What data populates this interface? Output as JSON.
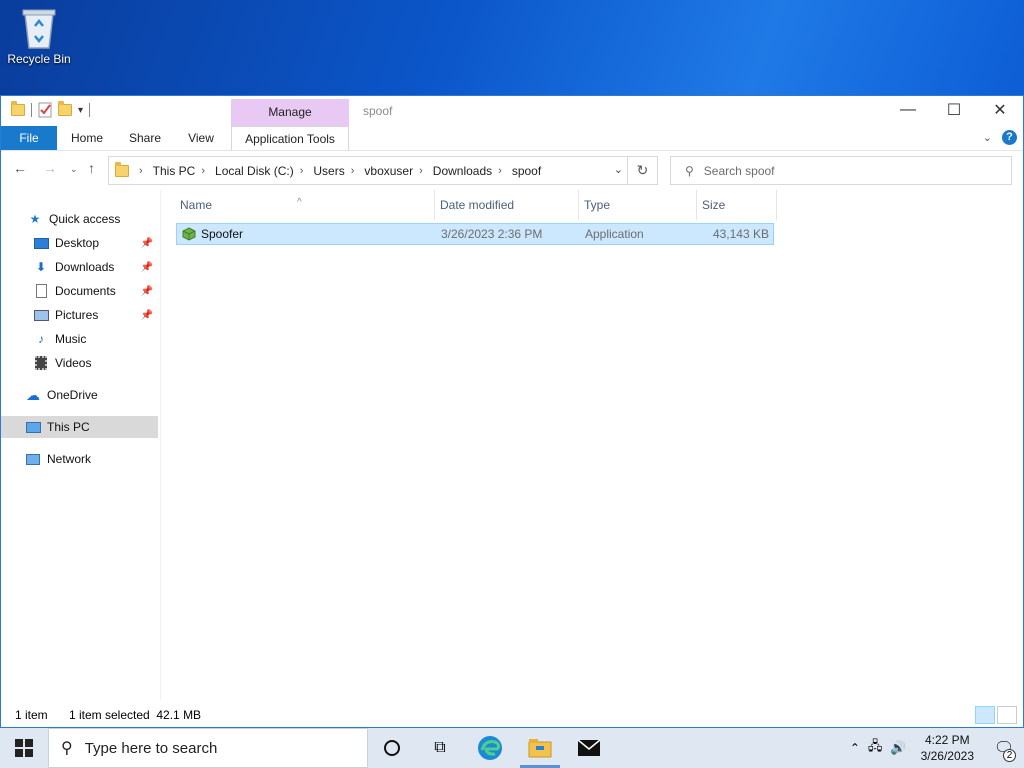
{
  "desktop": {
    "recycle_bin_label": "Recycle Bin"
  },
  "window": {
    "title": "spoof",
    "contextual_tab": "Manage",
    "ribbon_tabs": {
      "file": "File",
      "home": "Home",
      "share": "Share",
      "view": "View",
      "app_tools": "Application Tools"
    }
  },
  "address": {
    "crumbs": [
      "This PC",
      "Local Disk (C:)",
      "Users",
      "vboxuser",
      "Downloads",
      "spoof"
    ]
  },
  "search": {
    "placeholder": "Search spoof"
  },
  "nav": {
    "quick_access": "Quick access",
    "desktop": "Desktop",
    "downloads": "Downloads",
    "documents": "Documents",
    "pictures": "Pictures",
    "music": "Music",
    "videos": "Videos",
    "onedrive": "OneDrive",
    "this_pc": "This PC",
    "network": "Network"
  },
  "columns": {
    "name": "Name",
    "date": "Date modified",
    "type": "Type",
    "size": "Size"
  },
  "files": [
    {
      "name": "Spoofer",
      "date": "3/26/2023 2:36 PM",
      "type": "Application",
      "size": "43,143 KB"
    }
  ],
  "status": {
    "count": "1 item",
    "selected": "1 item selected  42.1 MB"
  },
  "taskbar": {
    "search_placeholder": "Type here to search",
    "time": "4:22 PM",
    "date": "3/26/2023",
    "notification_count": "2"
  },
  "colors": {
    "accent": "#1979ca",
    "selection": "#cce8ff",
    "manage_tab": "#e8c9f3"
  }
}
